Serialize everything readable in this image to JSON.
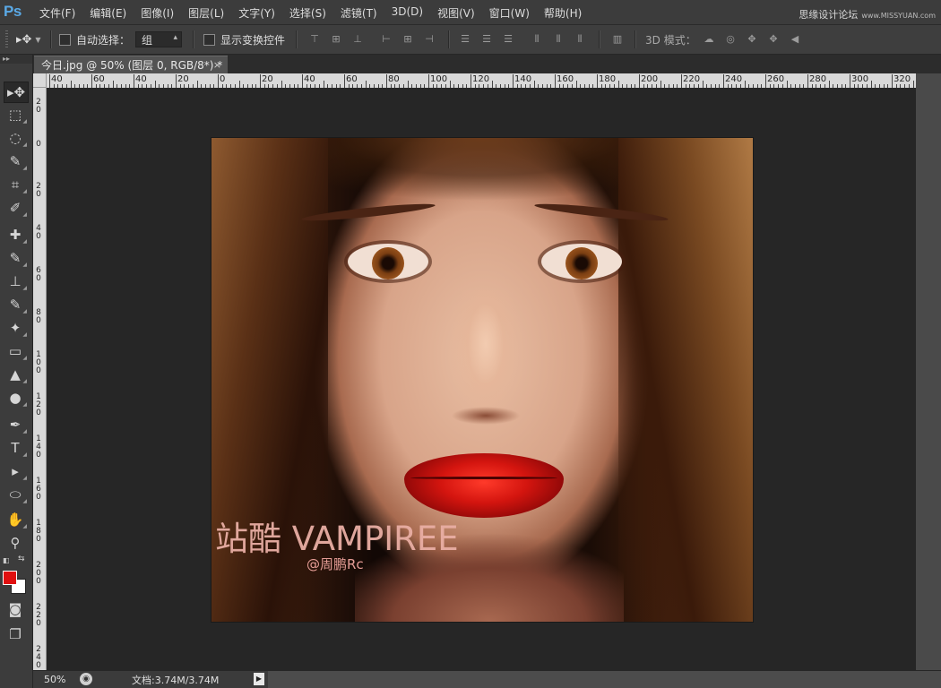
{
  "app": {
    "logo": "Ps",
    "menu": [
      "文件(F)",
      "编辑(E)",
      "图像(I)",
      "图层(L)",
      "文字(Y)",
      "选择(S)",
      "滤镜(T)",
      "3D(D)",
      "视图(V)",
      "窗口(W)",
      "帮助(H)"
    ],
    "watermark": "思缘设计论坛",
    "watermark_url": "www.MISSYUAN.com"
  },
  "options": {
    "move_icon": "move-tool-icon",
    "auto_select_label": "自动选择：",
    "auto_select_value": "组",
    "show_transform_label": "显示变换控件",
    "mode_3d_label": "3D 模式："
  },
  "document": {
    "tab_title": "今日.jpg @ 50% (图层 0, RGB/8*) *",
    "close_glyph": "×"
  },
  "ruler": {
    "h_labels": [
      "40",
      "60",
      "40",
      "20",
      "0",
      "20",
      "40",
      "60",
      "80",
      "100",
      "120",
      "140",
      "160",
      "180",
      "200",
      "220",
      "240",
      "260",
      "280",
      "300",
      "320"
    ],
    "v_labels": [
      "20",
      "0",
      "20",
      "40",
      "60",
      "80",
      "100",
      "120",
      "140",
      "160",
      "180",
      "200",
      "220",
      "240"
    ]
  },
  "image": {
    "caption_title": "站酷 VAMPIREE",
    "caption_author": "@周鹏Rc"
  },
  "colors": {
    "foreground": "#e01010",
    "background": "#ffffff"
  },
  "status": {
    "zoom": "50%",
    "doc_size": "文档:3.74M/3.74M",
    "arrow": "▶"
  },
  "tools": [
    "move-tool",
    "marquee-tool",
    "lasso-tool",
    "quick-select-tool",
    "crop-tool",
    "eyedropper-tool",
    "healing-brush-tool",
    "brush-tool",
    "clone-stamp-tool",
    "history-brush-tool",
    "eraser-tool",
    "gradient-tool",
    "blur-tool",
    "dodge-tool",
    "pen-tool",
    "type-tool",
    "path-select-tool",
    "ellipse-tool",
    "hand-tool",
    "zoom-tool",
    "quick-mask-mode",
    "screen-mode"
  ]
}
